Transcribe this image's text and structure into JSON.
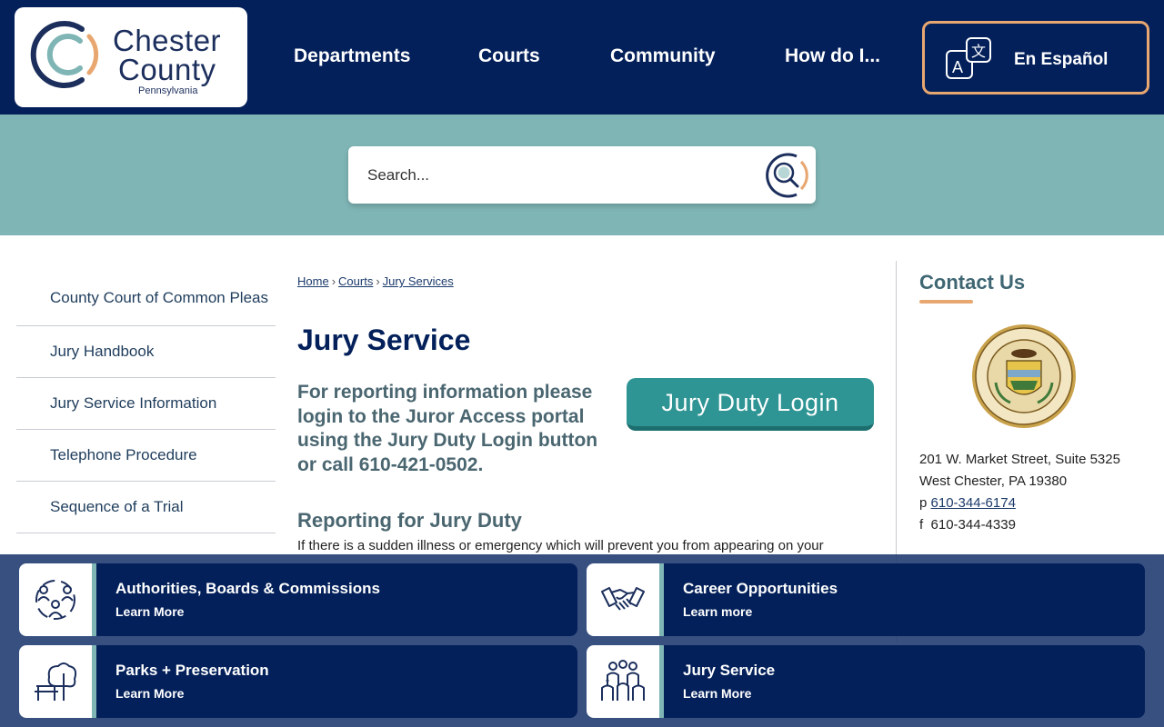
{
  "header": {
    "logo": {
      "line1": "Chester",
      "line2": "County",
      "line3": "Pennsylvania"
    },
    "nav": [
      "Departments",
      "Courts",
      "Community",
      "How do I..."
    ],
    "language_button": "En Español"
  },
  "search": {
    "placeholder": "Search..."
  },
  "sidebar": {
    "items": [
      "County Court of Common Pleas",
      "Jury Handbook",
      "Jury Service Information",
      "Telephone Procedure",
      "Sequence of a Trial"
    ]
  },
  "breadcrumb": {
    "home": "Home",
    "courts": "Courts",
    "current": "Jury Services",
    "sep": "›"
  },
  "main": {
    "title": "Jury Service",
    "intro": "For reporting information please login to the Juror Access portal using the Jury Duty Login button or call 610-421-0502.",
    "login_button": "Jury Duty Login",
    "section_heading": "Reporting for Jury Duty",
    "section_text": "If there is a sudden illness or emergency which will prevent you from appearing on your"
  },
  "contact": {
    "heading": "Contact Us",
    "address1": "201 W. Market Street, Suite 5325",
    "address2": "West Chester, PA 19380",
    "phone_prefix": "p",
    "phone": "610-344-6174",
    "fax_prefix": "f",
    "fax": "610-344-4339"
  },
  "quick_links": [
    {
      "title": "Authorities, Boards & Commissions",
      "link": "Learn More",
      "icon": "people-group-icon"
    },
    {
      "title": "Career Opportunities",
      "link": "Learn more",
      "icon": "handshake-icon"
    },
    {
      "title": "Parks + Preservation",
      "link": "Learn More",
      "icon": "park-bench-tree-icon"
    },
    {
      "title": "Jury Service",
      "link": "Learn More",
      "icon": "jury-people-icon"
    }
  ],
  "colors": {
    "navy": "#03205a",
    "teal_band": "#7fb5b5",
    "orange_accent": "#e8a770",
    "teal_button": "#2f9494"
  }
}
